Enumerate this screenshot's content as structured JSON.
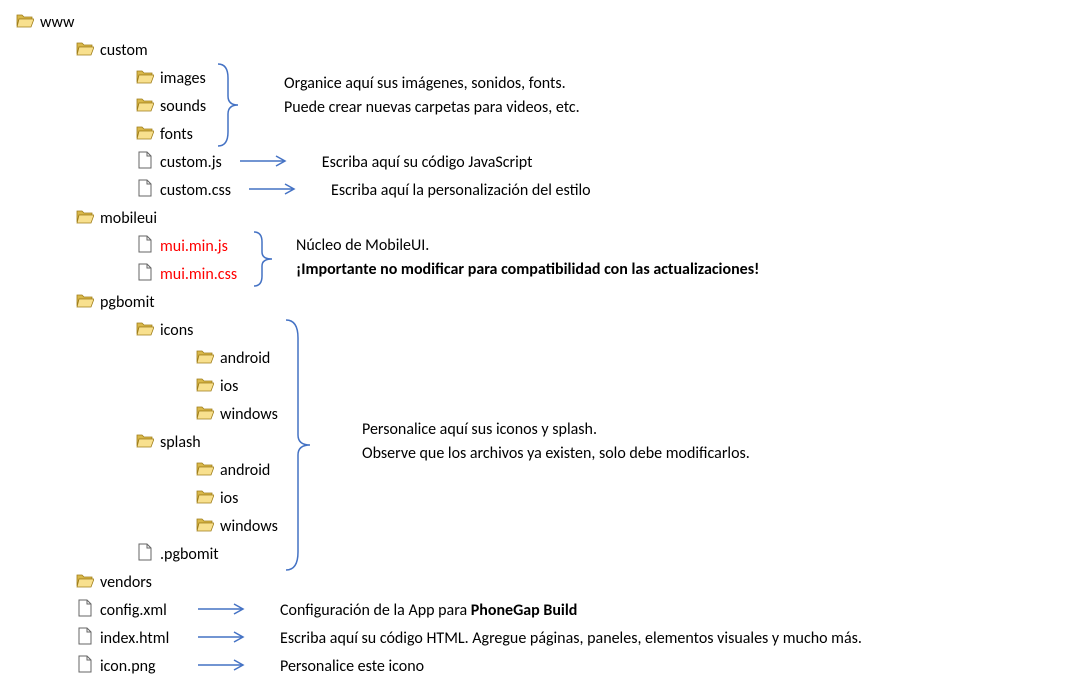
{
  "tree": {
    "root": "www",
    "custom": "custom",
    "custom_images": "images",
    "custom_sounds": "sounds",
    "custom_fonts": "fonts",
    "custom_js": "custom.js",
    "custom_css": "custom.css",
    "mobileui": "mobileui",
    "mui_js": "mui.min.js",
    "mui_css": "mui.min.css",
    "pgbomit": "pgbomit",
    "icons": "icons",
    "icons_android": "android",
    "icons_ios": "ios",
    "icons_windows": "windows",
    "splash": "splash",
    "splash_android": "android",
    "splash_ios": "ios",
    "splash_windows": "windows",
    "pgbomit_file": ".pgbomit",
    "vendors": "vendors",
    "config_xml": "config.xml",
    "index_html": "index.html",
    "icon_png": "icon.png"
  },
  "notes": {
    "img_line1": "Organice aquí sus imágenes, sonidos, fonts.",
    "img_line2": "Puede crear nuevas carpetas para videos, etc.",
    "custom_js_note": "Escriba aquí su código JavaScript",
    "custom_css_note": "Escriba aquí la personalización del estilo",
    "mui_line1": "Núcleo de MobileUI.",
    "mui_line2": "¡Importante no modificar para compatibilidad con las actualizaciones!",
    "pg_line1": "Personalice aquí sus iconos y splash.",
    "pg_line2": "Observe que los archivos ya existen, solo debe modificarlos.",
    "config_note_prefix": "Configuración de la App para ",
    "config_note_bold": "PhoneGap Build",
    "index_note": "Escriba aquí su código HTML. Agregue páginas, paneles, elementos visuales y mucho más.",
    "iconpng_note": "Personalice este icono"
  }
}
